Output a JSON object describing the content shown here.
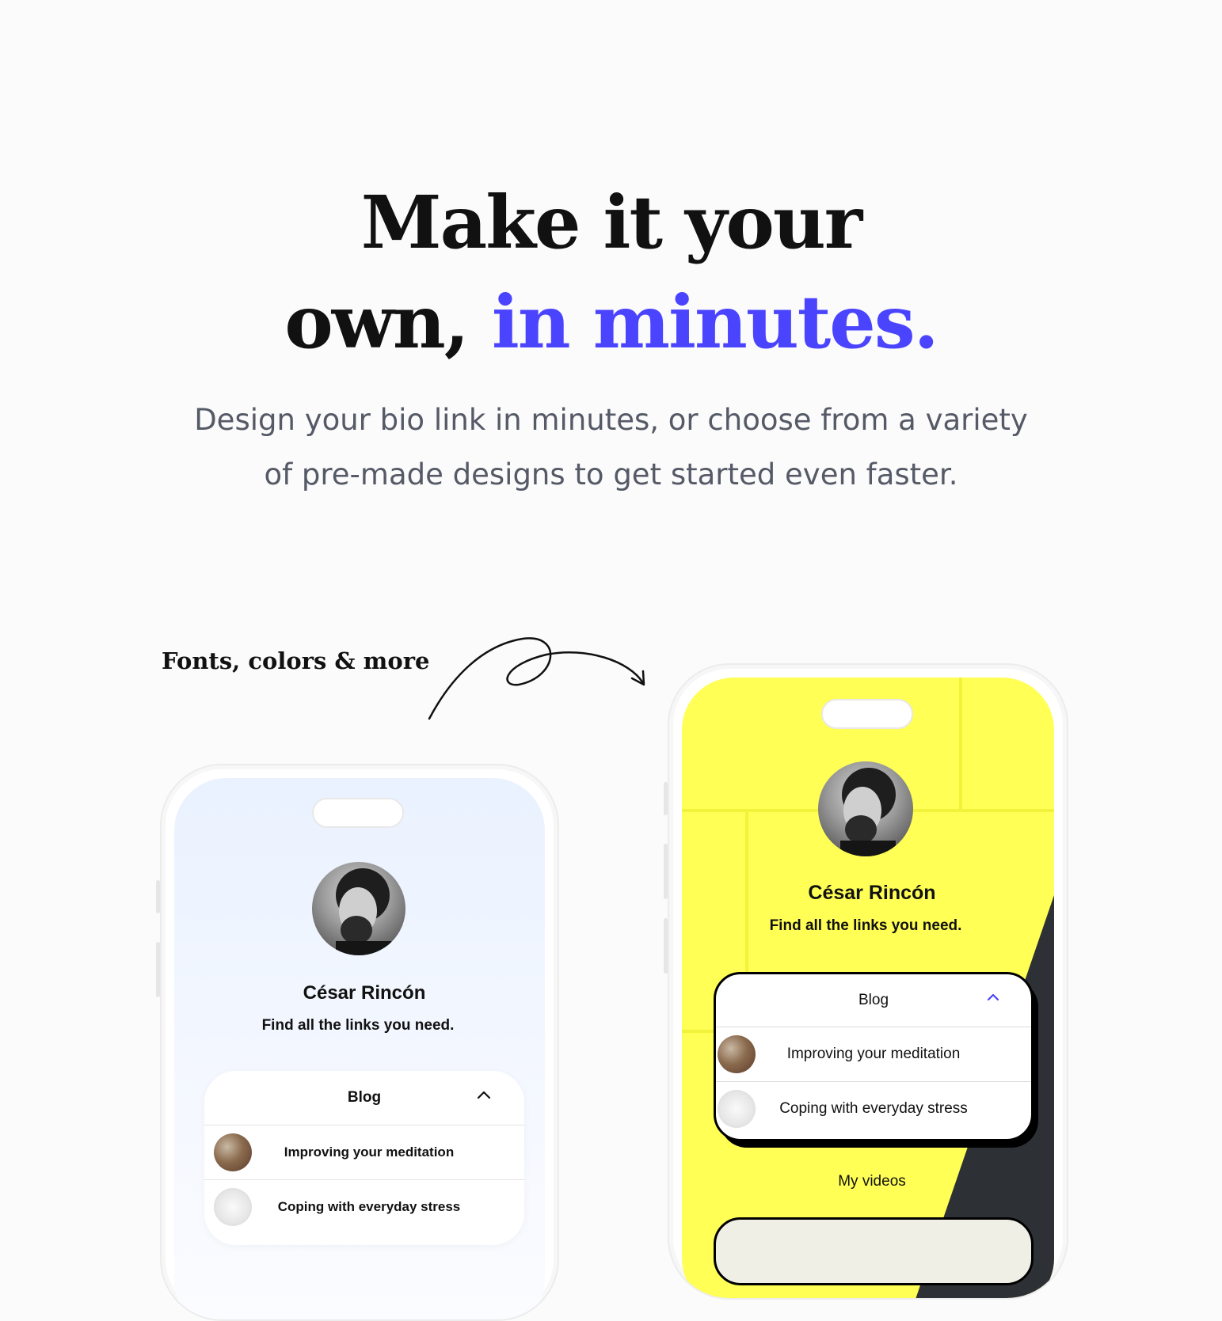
{
  "hero": {
    "title_line1": "Make it your",
    "title_line2_plain": "own, ",
    "title_line2_accent": "in minutes.",
    "subtitle": "Design your bio link in minutes, or choose from a variety of pre-made designs to get started even faster."
  },
  "callout": "Fonts, colors & more",
  "colors": {
    "accent": "#4a44ff",
    "phone2_background": "#ffff55"
  },
  "profile": {
    "name": "César Rincón",
    "tagline": "Find all the links you need."
  },
  "blog_card": {
    "title": "Blog",
    "items": [
      {
        "label": "Improving your meditation",
        "thumb": "meditation-thumbnail"
      },
      {
        "label": "Coping with everyday stress",
        "thumb": "stress-thumbnail"
      }
    ]
  },
  "videos_section": "My videos",
  "icons": {
    "collapse": "chevron-up-icon",
    "arrow": "curly-arrow-icon"
  }
}
